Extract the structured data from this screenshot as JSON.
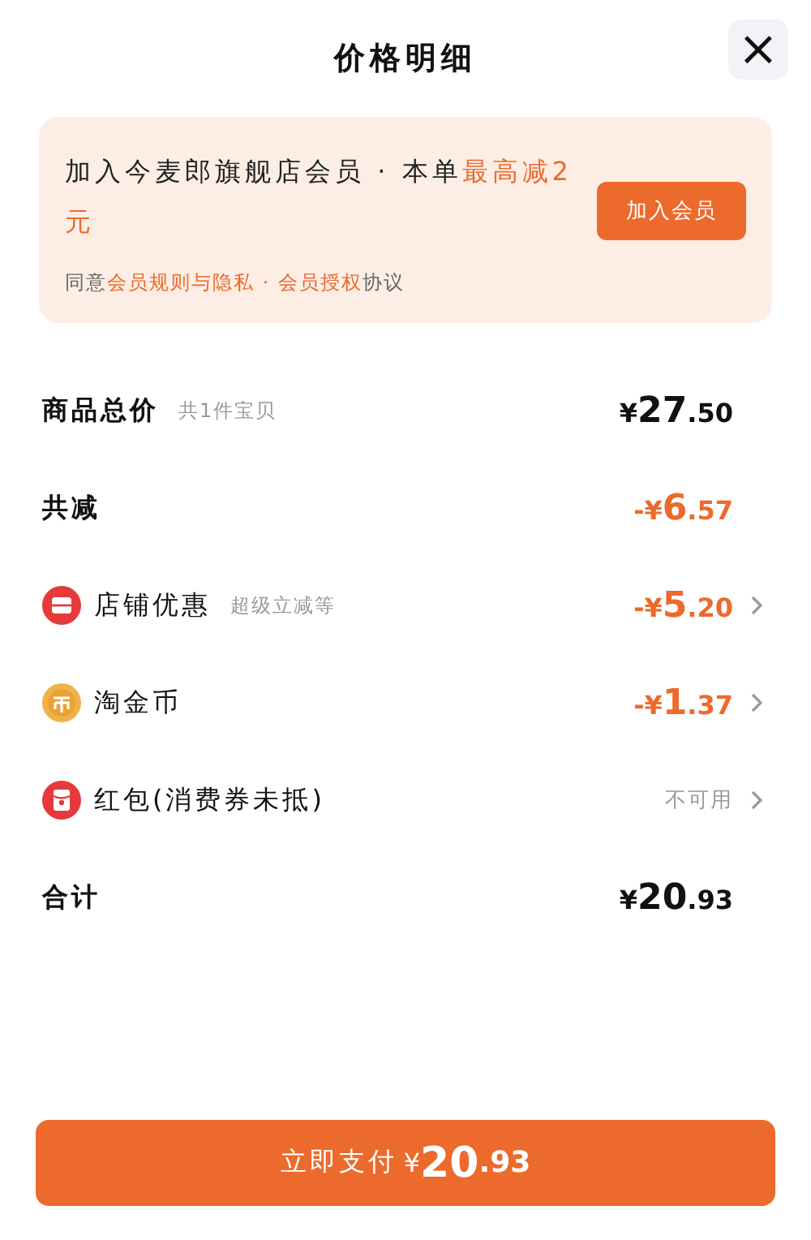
{
  "header": {
    "title": "价格明细",
    "close": "×"
  },
  "banner": {
    "message": [
      {
        "text": "加入今麦郎旗舰店会员 · 本单",
        "highlight": false
      },
      {
        "text": "最高减2元",
        "highlight": true
      }
    ],
    "agreement": [
      {
        "text": "同意",
        "kind": "plain"
      },
      {
        "text": "会员规则与隐私",
        "kind": "link"
      },
      {
        "text": " · ",
        "kind": "separator"
      },
      {
        "text": "会员授权",
        "kind": "link"
      },
      {
        "text": "协议",
        "kind": "plain"
      }
    ],
    "button": "加入会员"
  },
  "rows": [
    {
      "kind": "subtotal",
      "label": "商品总价",
      "note": "共1件宝贝",
      "amount": {
        "sign": "¥",
        "whole": "27",
        "cents": ".50"
      },
      "deducted": false,
      "chevron": false
    },
    {
      "kind": "discount",
      "label": "共减",
      "amount": {
        "sign": "-¥",
        "whole": "6",
        "cents": ".57"
      },
      "deducted": true,
      "chevron": false
    },
    {
      "kind": "store",
      "label": "店铺优惠",
      "note": "超级立减等",
      "amount": {
        "sign": "-¥",
        "whole": "5",
        "cents": ".20"
      },
      "deducted": true,
      "chevron": true
    },
    {
      "kind": "coin",
      "label": "淘金币",
      "amount": {
        "sign": "-¥",
        "whole": "1",
        "cents": ".37"
      },
      "deducted": true,
      "chevron": true
    },
    {
      "kind": "packet",
      "label": "红包(消费券未抵)",
      "status": "不可用",
      "chevron": true
    },
    {
      "kind": "total",
      "label": "合计",
      "amount": {
        "sign": "¥",
        "whole": "20",
        "cents": ".93"
      },
      "deducted": false,
      "chevron": false
    }
  ],
  "pay_button": {
    "label": "立即支付",
    "amount": {
      "sign": "¥",
      "whole": "20",
      "cents": ".93"
    }
  }
}
